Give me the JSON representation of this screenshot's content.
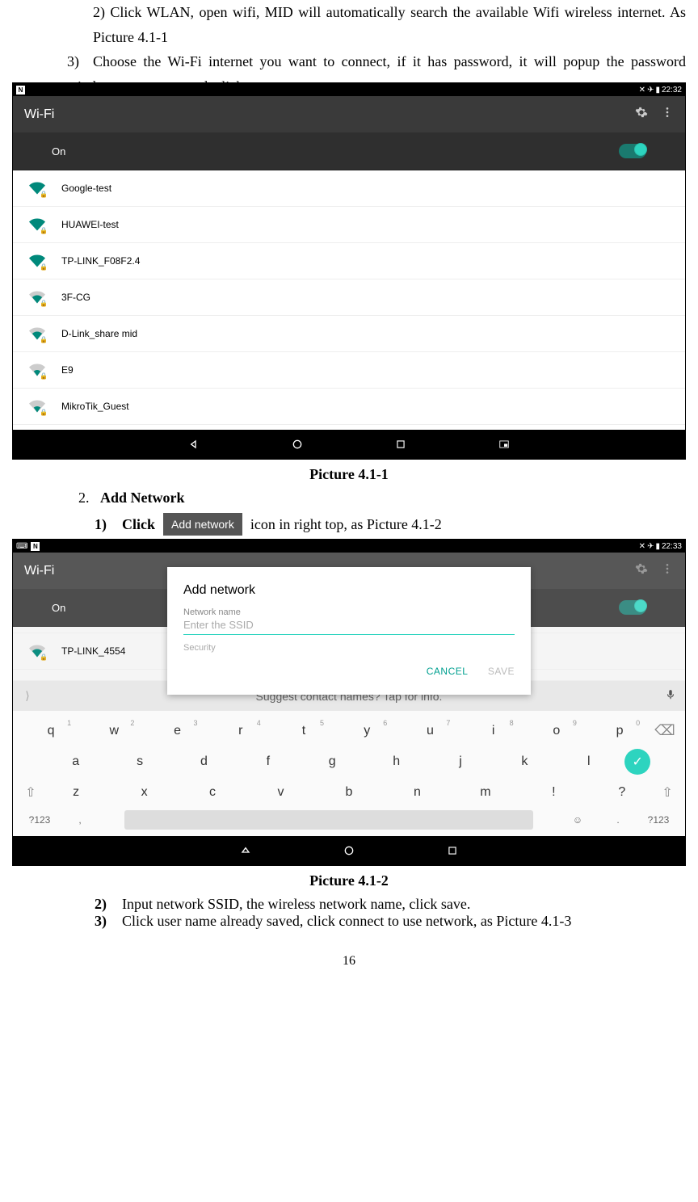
{
  "intro": {
    "step2": "2) Click WLAN, open wifi, MID will automatically search the available Wifi wireless internet. As Picture 4.1-1",
    "step3_num": "3)",
    "step3": "Choose the Wi-Fi internet you want to connect, if it has password, it will popup the password window, enter password, click connect."
  },
  "screenshot1": {
    "status": {
      "left": "N",
      "time": "22:32"
    },
    "header": "Wi-Fi",
    "toggle_label": "On",
    "networks": [
      "Google-test",
      "HUAWEI-test",
      "TP-LINK_F08F2.4",
      "3F-CG",
      "D-Link_share mid",
      "E9",
      "MikroTik_Guest"
    ]
  },
  "caption1": "Picture 4.1-1",
  "section2": {
    "num": "2.",
    "title": "Add Network"
  },
  "sub1": {
    "num": "1)",
    "label": "Click",
    "after": " icon in right top, as Picture 4.1-2",
    "badge": "Add network"
  },
  "screenshot2": {
    "status": {
      "left": "N",
      "extra": "N",
      "time": "22:33"
    },
    "header": "Wi-Fi",
    "toggle_label": "On",
    "networks_bg": [
      "TP-LINK_4554"
    ],
    "dialog": {
      "title": "Add network",
      "name_label": "Network name",
      "placeholder": "Enter the SSID",
      "security_label": "Security",
      "cancel": "CANCEL",
      "save": "SAVE"
    },
    "suggest": "Suggest contact names? Tap for info.",
    "keyboard": {
      "row1": [
        {
          "k": "q",
          "s": "1"
        },
        {
          "k": "w",
          "s": "2"
        },
        {
          "k": "e",
          "s": "3"
        },
        {
          "k": "r",
          "s": "4"
        },
        {
          "k": "t",
          "s": "5"
        },
        {
          "k": "y",
          "s": "6"
        },
        {
          "k": "u",
          "s": "7"
        },
        {
          "k": "i",
          "s": "8"
        },
        {
          "k": "o",
          "s": "9"
        },
        {
          "k": "p",
          "s": "0"
        }
      ],
      "row2": [
        "a",
        "s",
        "d",
        "f",
        "g",
        "h",
        "j",
        "k",
        "l"
      ],
      "row3": [
        "z",
        "x",
        "c",
        "v",
        "b",
        "n",
        "m",
        "!",
        "?"
      ],
      "sym": "?123",
      "comma": ",",
      "period": "."
    }
  },
  "caption2": "Picture 4.1-2",
  "sub2": {
    "num": "2)",
    "text": "Input network SSID, the wireless network name, click save."
  },
  "sub3": {
    "num": "3)",
    "text": "Click user name already saved, click connect to use network, as Picture 4.1-3"
  },
  "page_number": "16"
}
